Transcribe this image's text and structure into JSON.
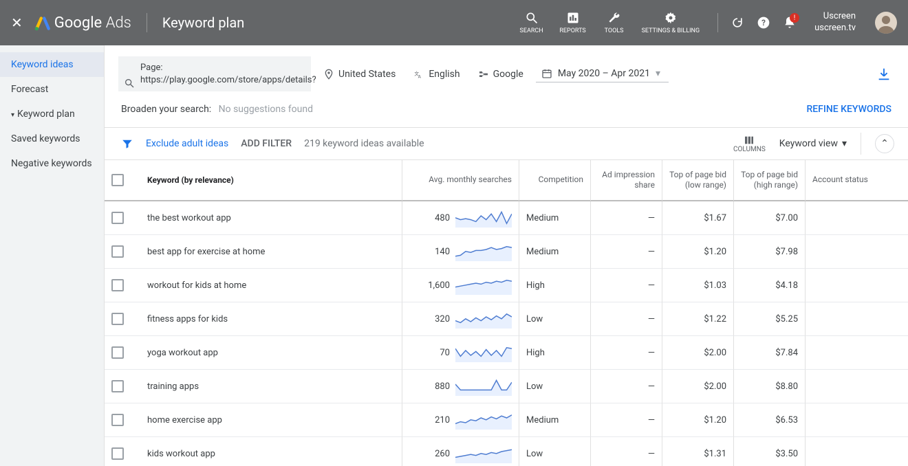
{
  "header": {
    "brand_a": "Google",
    "brand_b": "Ads",
    "page_title": "Keyword plan",
    "tools": [
      {
        "name": "search",
        "label": "SEARCH"
      },
      {
        "name": "reports",
        "label": "REPORTS"
      },
      {
        "name": "tools",
        "label": "TOOLS"
      },
      {
        "name": "settings",
        "label": "SETTINGS & BILLING"
      }
    ],
    "user_line1": "Uscreen",
    "user_line2": "uscreen.tv",
    "notif_badge": "!"
  },
  "sidebar": {
    "items": [
      {
        "label": "Keyword ideas",
        "active": true
      },
      {
        "label": "Forecast"
      },
      {
        "label": "Keyword plan",
        "caret": true
      },
      {
        "label": "Saved keywords"
      },
      {
        "label": "Negative keywords"
      }
    ]
  },
  "controls": {
    "seed_label": "Page:",
    "seed_url": "https://play.google.com/store/apps/details?",
    "location": "United States",
    "language": "English",
    "network": "Google",
    "date_range": "May 2020 – Apr 2021"
  },
  "broaden": {
    "label": "Broaden your search:",
    "note": "No suggestions found",
    "refine": "REFINE KEYWORDS"
  },
  "filters": {
    "exclude": "Exclude adult ideas",
    "add_filter": "ADD FILTER",
    "available": "219 keyword ideas available",
    "columns": "COLUMNS",
    "view": "Keyword view"
  },
  "table": {
    "headers": {
      "keyword": "Keyword (by relevance)",
      "searches": "Avg. monthly searches",
      "competition": "Competition",
      "impr": "Ad impression share",
      "low": "Top of page bid (low range)",
      "high": "Top of page bid (high range)",
      "account": "Account status"
    },
    "rows": [
      {
        "keyword": "the best workout app",
        "searches": "480",
        "competition": "Medium",
        "impr": "—",
        "low": "$1.67",
        "high": "$7.00",
        "spark": [
          8,
          6,
          7,
          6,
          4,
          10,
          6,
          12,
          4,
          14,
          2,
          12
        ]
      },
      {
        "keyword": "best app for exercise at home",
        "searches": "140",
        "competition": "Medium",
        "impr": "—",
        "low": "$1.20",
        "high": "$7.98",
        "spark": [
          3,
          4,
          8,
          7,
          9,
          9,
          10,
          12,
          10,
          11,
          13,
          12
        ]
      },
      {
        "keyword": "workout for kids at home",
        "searches": "1,600",
        "competition": "High",
        "impr": "—",
        "low": "$1.03",
        "high": "$4.18",
        "spark": [
          6,
          7,
          8,
          9,
          10,
          9,
          11,
          10,
          12,
          11,
          13,
          12
        ]
      },
      {
        "keyword": "fitness apps for kids",
        "searches": "320",
        "competition": "Low",
        "impr": "—",
        "low": "$1.22",
        "high": "$5.25",
        "spark": [
          6,
          4,
          8,
          5,
          9,
          6,
          10,
          7,
          11,
          8,
          13,
          10
        ]
      },
      {
        "keyword": "yoga workout app",
        "searches": "70",
        "competition": "High",
        "impr": "—",
        "low": "$2.00",
        "high": "$7.84",
        "spark": [
          12,
          4,
          10,
          5,
          9,
          4,
          11,
          5,
          10,
          4,
          13,
          12
        ]
      },
      {
        "keyword": "training apps",
        "searches": "880",
        "competition": "Low",
        "impr": "—",
        "low": "$2.00",
        "high": "$8.80",
        "spark": [
          10,
          4,
          4,
          4,
          4,
          4,
          4,
          4,
          14,
          4,
          4,
          12
        ]
      },
      {
        "keyword": "home exercise app",
        "searches": "210",
        "competition": "Medium",
        "impr": "—",
        "low": "$1.20",
        "high": "$6.53",
        "spark": [
          4,
          6,
          5,
          8,
          7,
          10,
          8,
          11,
          9,
          12,
          10,
          13
        ]
      },
      {
        "keyword": "kids workout app",
        "searches": "260",
        "competition": "Low",
        "impr": "—",
        "low": "$1.31",
        "high": "$3.50",
        "spark": [
          4,
          5,
          6,
          7,
          6,
          8,
          7,
          9,
          8,
          10,
          11,
          12
        ]
      }
    ]
  }
}
